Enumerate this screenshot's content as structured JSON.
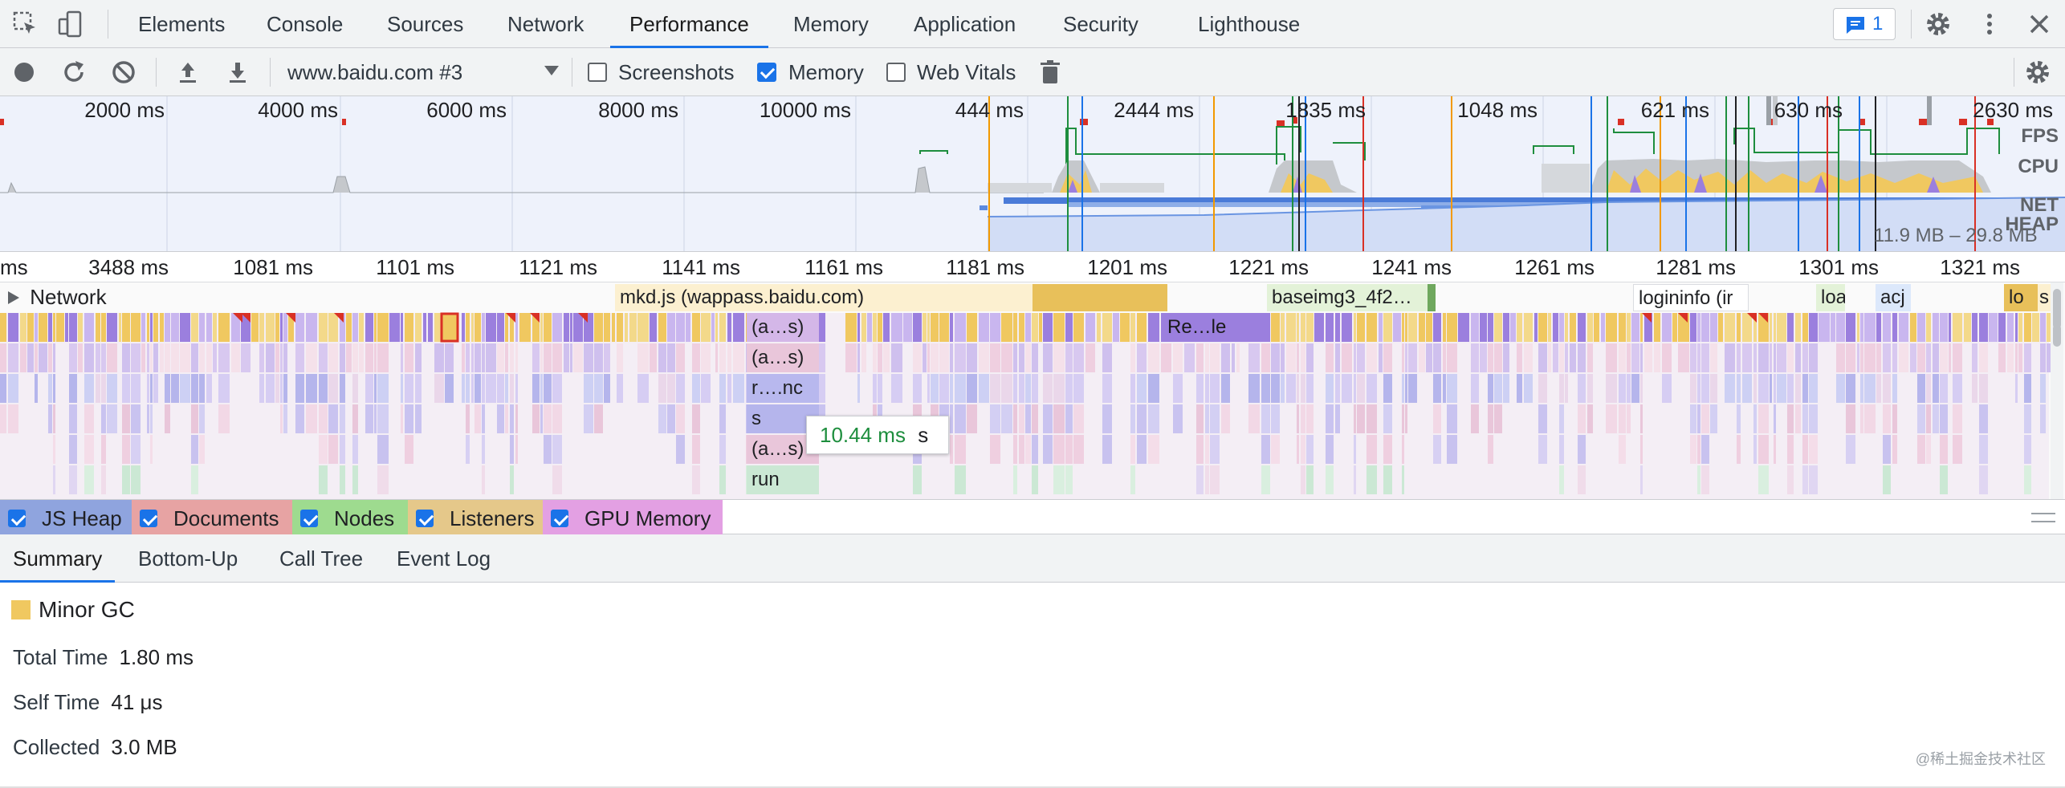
{
  "tabs": [
    "Elements",
    "Console",
    "Sources",
    "Network",
    "Performance",
    "Memory",
    "Application",
    "Security",
    "Lighthouse"
  ],
  "active_tab": "Performance",
  "message_count": "1",
  "toolbar": {
    "recording_select": "www.baidu.com #3",
    "screenshots_label": "Screenshots",
    "screenshots_checked": false,
    "memory_label": "Memory",
    "memory_checked": true,
    "webvitals_label": "Web Vitals",
    "webvitals_checked": false
  },
  "overview": {
    "time_labels": [
      "2000 ms",
      "4000 ms",
      "6000 ms",
      "8000 ms",
      "10000 ms",
      "444 ms",
      "2444 ms",
      "1835 ms",
      "1048 ms",
      "621 ms",
      "630 ms",
      "2630 ms"
    ],
    "side_labels": [
      "FPS",
      "CPU",
      "NET",
      "HEAP"
    ],
    "heap_range": "11.9 MB – 29.8 MB"
  },
  "ruler": [
    "ms",
    "3488 ms",
    "1081 ms",
    "1101 ms",
    "1121 ms",
    "1141 ms",
    "1161 ms",
    "1181 ms",
    "1201 ms",
    "1221 ms",
    "1241 ms",
    "1261 ms",
    "1281 ms",
    "1301 ms",
    "1321 ms"
  ],
  "network_label": "Network",
  "network_items": [
    "mkd.js (wappass.baidu.com)",
    "baseimg3_4f2…",
    "logininfo (ir",
    "loa",
    "acj",
    "lo",
    "s"
  ],
  "flame_labels": [
    "(a…s)",
    "(a…s)",
    "r….nc",
    "s",
    "(a…s)",
    "run",
    "Re…le"
  ],
  "tooltip": {
    "time": "10.44 ms",
    "name": "s"
  },
  "counters": [
    "JS Heap",
    "Documents",
    "Nodes",
    "Listeners",
    "GPU Memory"
  ],
  "counter_colors": [
    "#8fa4de",
    "#e7a3a3",
    "#9edb8f",
    "#e5c88a",
    "#e3a0e3"
  ],
  "bottom_tabs": [
    "Summary",
    "Bottom-Up",
    "Call Tree",
    "Event Log"
  ],
  "summary": {
    "title": "Minor GC",
    "color": "#f0c860",
    "total_time_label": "Total Time",
    "total_time": "1.80 ms",
    "self_time_label": "Self Time",
    "self_time": "41 μs",
    "collected_label": "Collected",
    "collected": "3.0 MB"
  },
  "watermark": "@稀土掘金技术社区"
}
